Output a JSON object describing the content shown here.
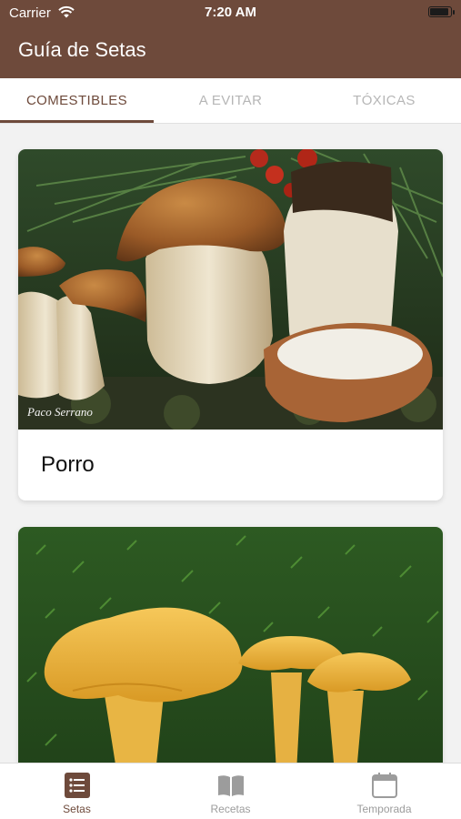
{
  "status": {
    "carrier": "Carrier",
    "time": "7:20 AM",
    "wifi_icon": "wifi-icon",
    "battery_icon": "battery-icon"
  },
  "header": {
    "title": "Guía de Setas"
  },
  "tabs": [
    {
      "label": "COMESTIBLES",
      "active": true
    },
    {
      "label": "A EVITAR",
      "active": false
    },
    {
      "label": "TÓXICAS",
      "active": false
    }
  ],
  "cards": [
    {
      "name": "Porro",
      "image": "mushroom-photo",
      "photo_credit": "Paco Serrano"
    },
    {
      "name": "",
      "image": "mushroom-photo"
    }
  ],
  "tabbar": [
    {
      "label": "Setas",
      "icon": "list-icon",
      "active": true
    },
    {
      "label": "Recetas",
      "icon": "book-icon",
      "active": false
    },
    {
      "label": "Temporada",
      "icon": "calendar-icon",
      "active": false
    }
  ],
  "colors": {
    "brand": "#6e4a3b",
    "inactive": "#9c9c9c",
    "background": "#f2f2f2"
  }
}
